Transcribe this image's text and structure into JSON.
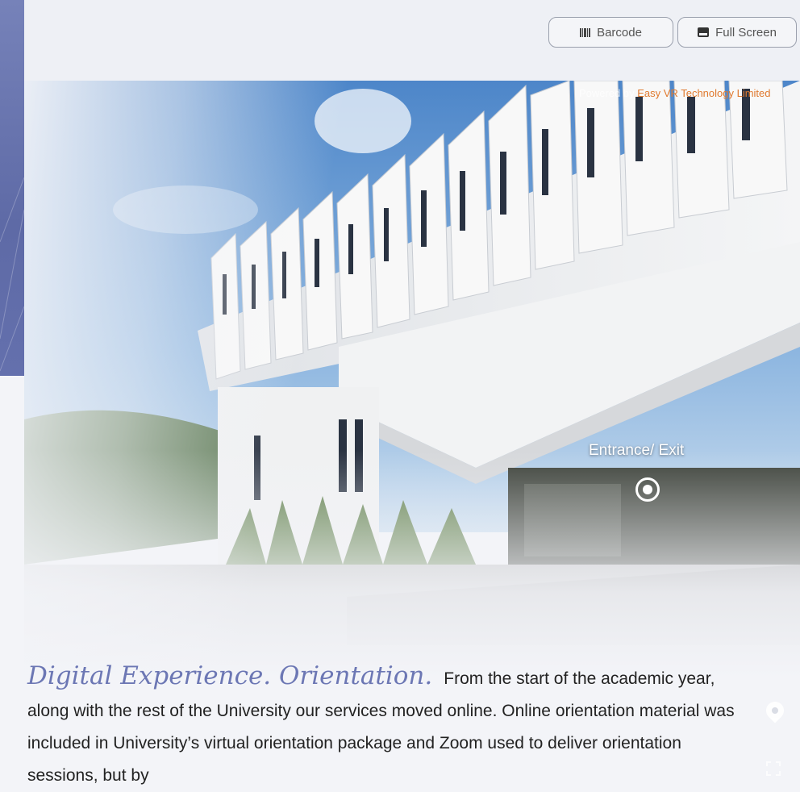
{
  "toolbar": {
    "barcode_label": "Barcode",
    "fullscreen_label": "Full Screen"
  },
  "scene": {
    "powered_prefix": "Powered by ",
    "powered_brand": "Easy VR Technology Limited",
    "hotspot_label": "Entrance/ Exit"
  },
  "article": {
    "heading": "Digital Experience. Orientation.",
    "body": "From the start of the academic year, along with the rest of the University our services moved online. Online orientation material was included in University’s virtual orientation package and Zoom used to deliver orientation sessions, but by"
  },
  "colors": {
    "accent": "#6c77b4",
    "left_bar": "#6470ad",
    "hotspot": "#ffffff",
    "brand": "#e07a2f"
  },
  "icons": [
    "barcode-icon",
    "fullscreen-icon",
    "target-icon",
    "location-pin-icon",
    "expand-icon"
  ]
}
